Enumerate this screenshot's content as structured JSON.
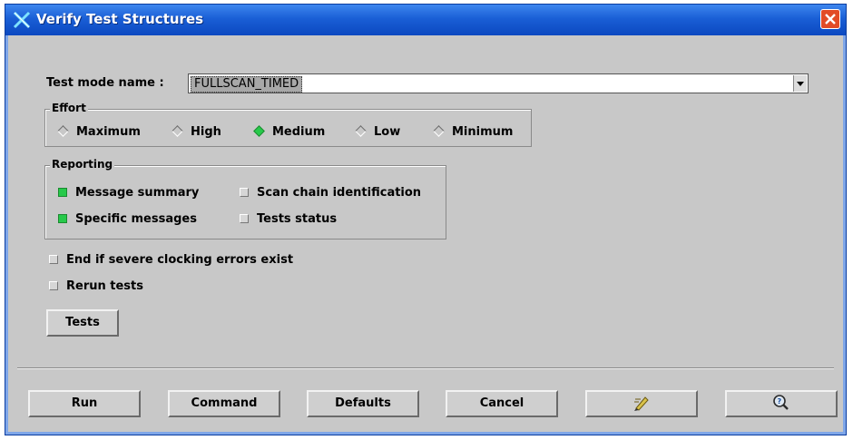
{
  "window": {
    "title": "Verify Test Structures"
  },
  "test_mode": {
    "label": "Test mode name :",
    "value": "FULLSCAN_TIMED"
  },
  "effort": {
    "title": "Effort",
    "options": [
      {
        "label": "Maximum",
        "selected": false
      },
      {
        "label": "High",
        "selected": false
      },
      {
        "label": "Medium",
        "selected": true
      },
      {
        "label": "Low",
        "selected": false
      },
      {
        "label": "Minimum",
        "selected": false
      }
    ]
  },
  "reporting": {
    "title": "Reporting",
    "items": [
      {
        "label": "Message summary",
        "checked": true
      },
      {
        "label": "Scan chain identification",
        "checked": false
      },
      {
        "label": "Specific messages",
        "checked": true
      },
      {
        "label": "Tests status",
        "checked": false
      }
    ]
  },
  "options": {
    "end_if_errors": {
      "label": "End if severe clocking errors exist",
      "checked": false
    },
    "rerun_tests": {
      "label": "Rerun tests",
      "checked": false
    }
  },
  "tests_button": {
    "label": "Tests"
  },
  "footer": {
    "run": "Run",
    "command": "Command",
    "defaults": "Defaults",
    "cancel": "Cancel",
    "edit_icon": "pencil-edit-icon",
    "help_icon": "magnifier-help-icon"
  },
  "colors": {
    "selected": "#27c94a",
    "titlebar": "#1a5fd6",
    "dialog_bg": "#c8c8c8"
  }
}
